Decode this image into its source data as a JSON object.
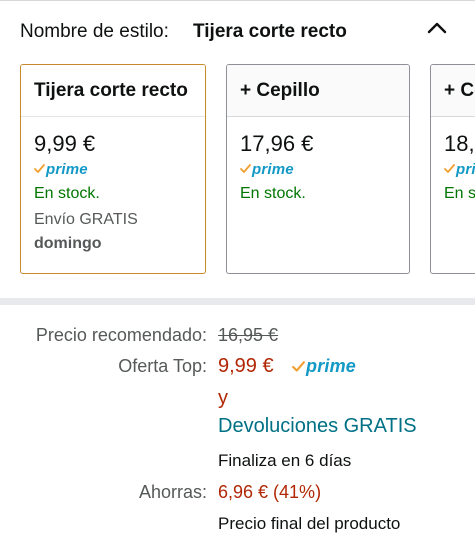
{
  "style_selector": {
    "label": "Nombre de estilo:",
    "selected_value": "Tijera corte recto",
    "collapse_icon": "chevron-up-icon"
  },
  "options": [
    {
      "name": "Tijera corte recto",
      "price": "9,99 €",
      "prime_label": "prime",
      "stock": "En stock.",
      "shipping": "Envío GRATIS",
      "delivery_day": "domingo",
      "selected": true
    },
    {
      "name": "+ Cepillo",
      "price": "17,96 €",
      "prime_label": "prime",
      "stock": "En stock.",
      "selected": false
    },
    {
      "name": "+ Co",
      "price": "18,",
      "prime_label": "pri",
      "stock": "En s",
      "selected": false
    }
  ],
  "pricing": {
    "recommended_label": "Precio recomendado:",
    "recommended_price": "16,95 €",
    "offer_label": "Oferta Top:",
    "offer_price": "9,99 €",
    "offer_prime": "prime",
    "conjunction": "y",
    "returns": "Devoluciones GRATIS",
    "ends": "Finaliza en 6 días",
    "savings_label": "Ahorras:",
    "savings_value": "6,96 € (41%)",
    "final_note": "Precio final del producto"
  },
  "colors": {
    "accent_orange": "#c8892b",
    "price_red": "#b12704",
    "stock_green": "#007600",
    "prime_blue": "#1399c6",
    "link_teal": "#007185"
  }
}
